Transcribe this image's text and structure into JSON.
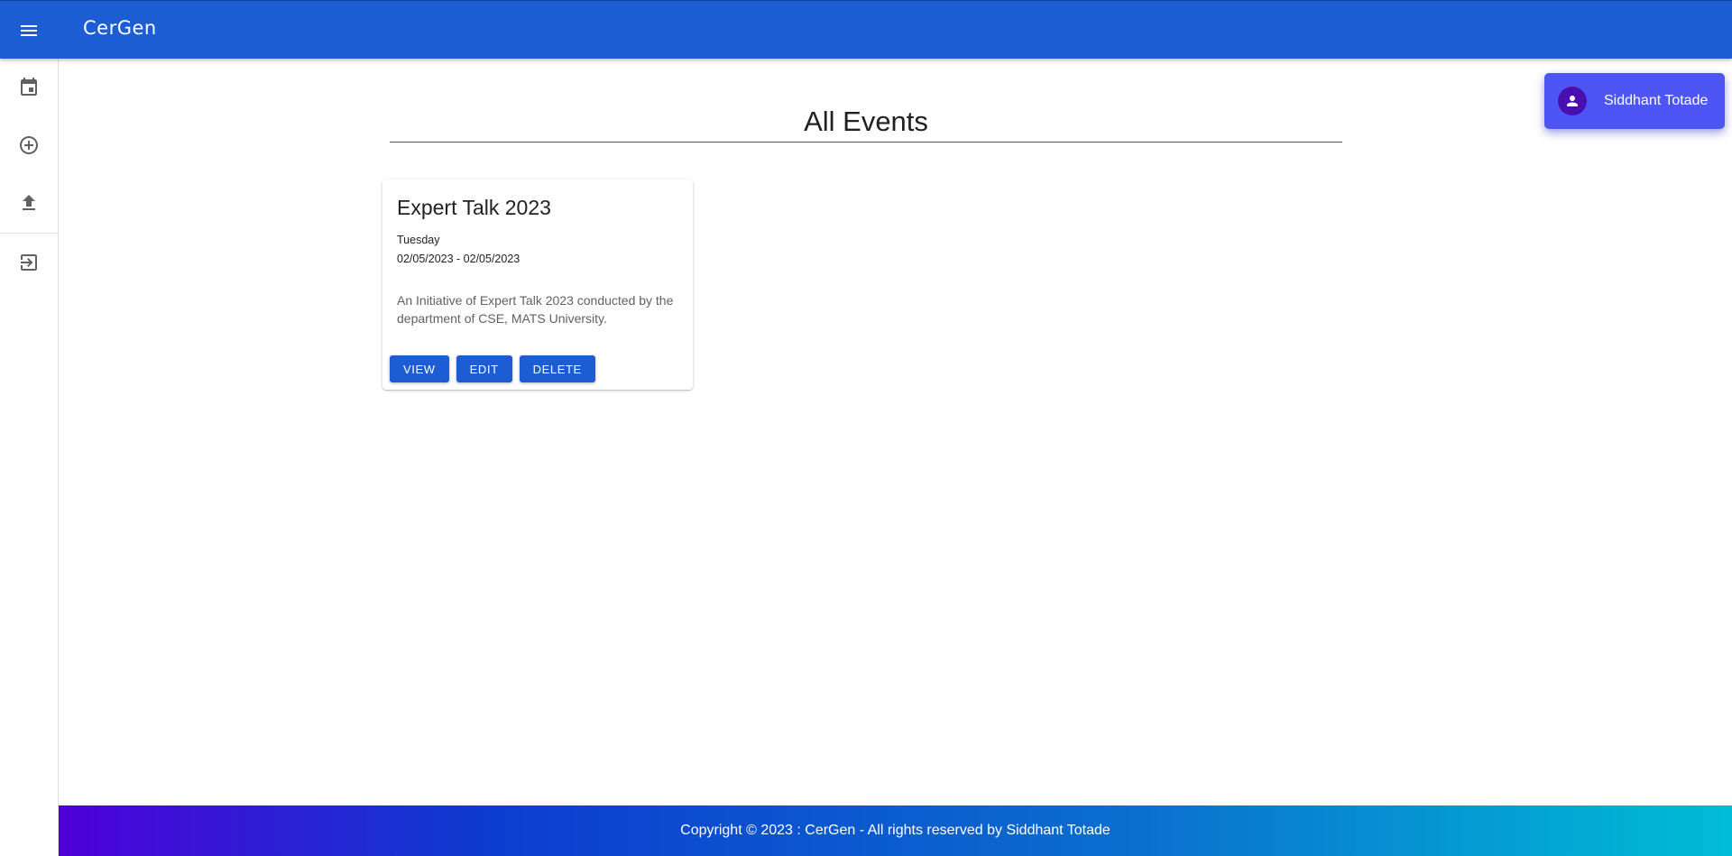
{
  "app": {
    "title": "CerGen"
  },
  "colors": {
    "primary": "#1c5dd4",
    "user_chip": "#4d55f5",
    "avatar": "#4a0fb0"
  },
  "sidebar": {
    "items": [
      {
        "icon": "calendar-icon"
      },
      {
        "icon": "add-circle-icon"
      },
      {
        "icon": "upload-icon"
      },
      {
        "icon": "logout-icon"
      }
    ]
  },
  "user": {
    "name": "Siddhant Totade"
  },
  "main": {
    "title": "All Events",
    "events": [
      {
        "title": "Expert Talk 2023",
        "day": "Tuesday",
        "dates": "02/05/2023 - 02/05/2023",
        "description": "An Initiative of Expert Talk 2023 conducted by the department of CSE, MATS University.",
        "actions": {
          "view": "VIEW",
          "edit": "EDIT",
          "delete": "DELETE"
        }
      }
    ]
  },
  "footer": {
    "text": "Copyright © 2023 : CerGen - All rights reserved by Siddhant Totade"
  }
}
